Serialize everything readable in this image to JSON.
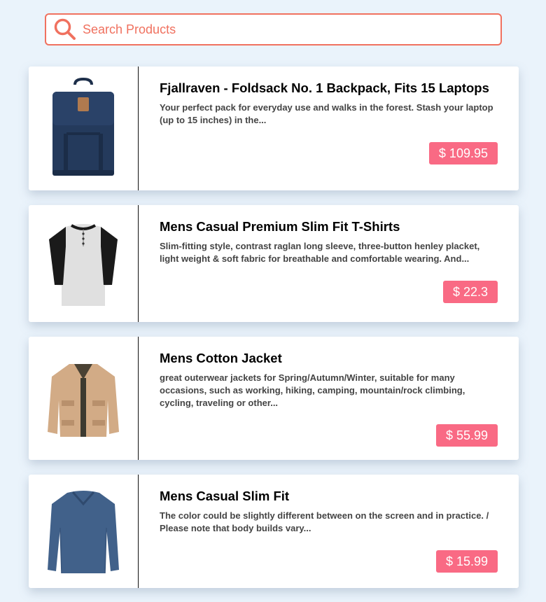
{
  "search": {
    "placeholder": "Search Products",
    "value": "",
    "accent_color": "#f0715f",
    "icon": "search-icon"
  },
  "products": [
    {
      "title": "Fjallraven - Foldsack No. 1 Backpack, Fits 15 Laptops",
      "description": "Your perfect pack for everyday use and walks in the forest. Stash your laptop (up to 15 inches) in the...",
      "price": "$ 109.95",
      "image": "backpack-image"
    },
    {
      "title": "Mens Casual Premium Slim Fit T-Shirts",
      "description": "Slim-fitting style, contrast raglan long sleeve, three-button henley placket, light weight & soft fabric for breathable and comfortable wearing. And...",
      "price": "$ 22.3",
      "image": "tshirt-image"
    },
    {
      "title": "Mens Cotton Jacket",
      "description": "great outerwear jackets for Spring/Autumn/Winter, suitable for many occasions, such as working, hiking, camping, mountain/rock climbing, cycling, traveling or other...",
      "price": "$ 55.99",
      "image": "jacket-image"
    },
    {
      "title": "Mens Casual Slim Fit",
      "description": "The color could be slightly different between on the screen and in practice. / Please note that body builds vary...",
      "price": "$ 15.99",
      "image": "longsleeve-image"
    }
  ],
  "colors": {
    "background": "#eaf3fb",
    "price_tag": "#f96a84",
    "card": "#ffffff"
  }
}
